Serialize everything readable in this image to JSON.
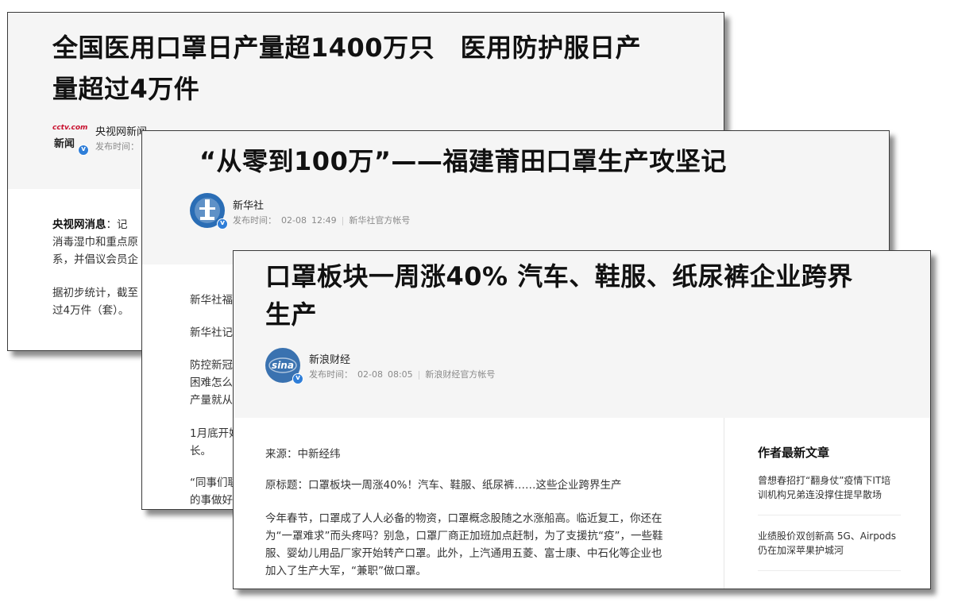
{
  "card1": {
    "title_line1": "全国医用口罩日产量超1400万只　医用防护服日产",
    "title_line2": "量超过4万件",
    "logo_brand": "cctv.com",
    "logo_text": "新闻",
    "author": "央视网新闻",
    "meta_label": "发布时间：",
    "para1_bold": "央视网消息",
    "para1_rest": "：记",
    "para1_line2": "消毒湿巾和重点原",
    "para1_line3": "系，并倡议会员企",
    "para2_line1": "据初步统计，截至",
    "para2_line2": "过4万件（套）。"
  },
  "card2": {
    "title": "“从零到100万”——福建莆田口罩生产攻坚记",
    "author": "新华社",
    "meta_label": "发布时间：",
    "meta_date": "02-08",
    "meta_time": "12:49",
    "meta_account": "新华社官方帐号",
    "lines": [
      "新华社福",
      "新华社记",
      "防控新冠",
      "困难怎么",
      "产量就从",
      "1月底开始",
      "长。",
      "“同事们联",
      "的事做好"
    ]
  },
  "card3": {
    "title_line1": "口罩板块一周涨40% 汽车、鞋服、纸尿裤企业跨界",
    "title_line2": "生产",
    "author": "新浪财经",
    "meta_label": "发布时间：",
    "meta_date": "02-08",
    "meta_time": "08:05",
    "meta_account": "新浪财经官方帐号",
    "source": "来源：中新经纬",
    "orig_title": "原标题：口罩板块一周涨40%！汽车、鞋服、纸尿裤……这些企业跨界生产",
    "body_lines": [
      "今年春节，口罩成了人人必备的物资，口罩概念股随之水涨船高。临近复工，你还在",
      "为“一罩难求”而头疼吗？别急，口罩厂商正加班加点赶制，为了支援抗“疫”，一些鞋",
      "服、婴幼儿用品厂家开始转产口罩。此外，上汽通用五菱、富士康、中石化等企业也",
      "加入了生产大军，“兼职”做口罩。"
    ],
    "sidebar_title": "作者最新文章",
    "sidebar_items": [
      {
        "line1": "曾想春招打“翻身仗”疫情下IT培",
        "line2": "训机构兄弟连没撑住提早散场"
      },
      {
        "line1": "业绩股价双创新高 5G、Airpods",
        "line2": "仍在加深苹果护城河"
      }
    ]
  }
}
